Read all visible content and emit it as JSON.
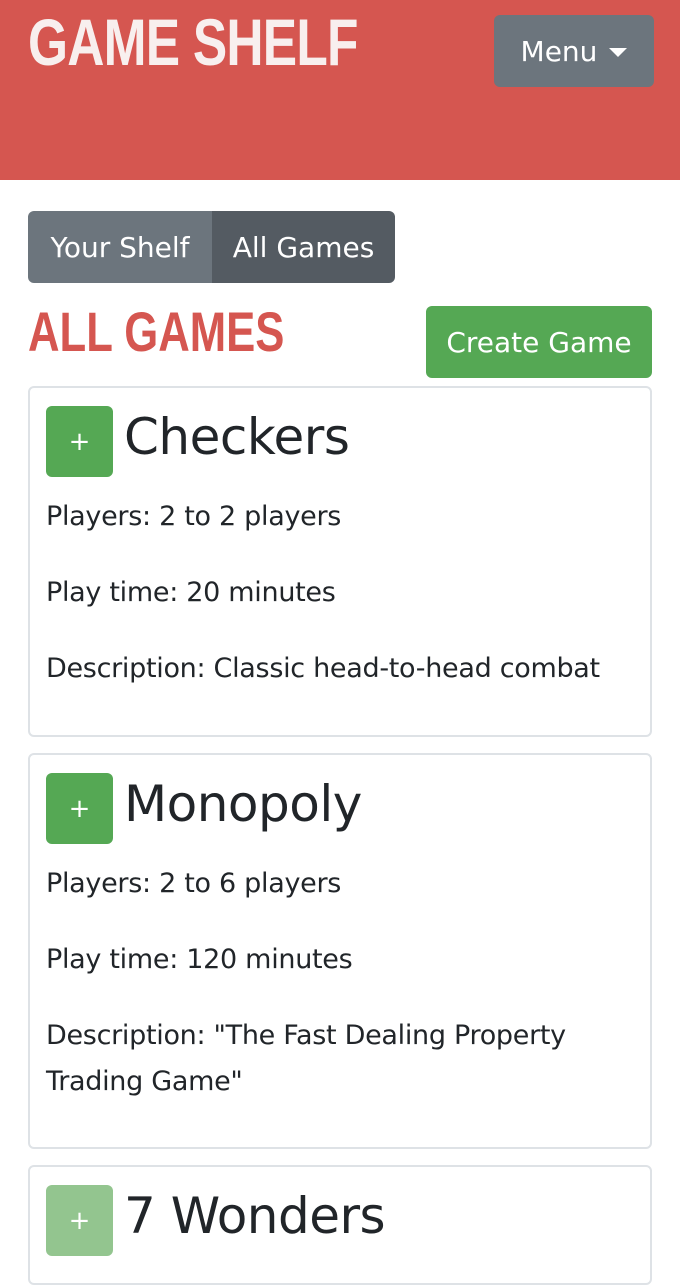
{
  "header": {
    "brand": "GAME SHELF",
    "menu_label": "Menu",
    "menu_icon": "chevron-down-icon"
  },
  "tabs": [
    {
      "label": "Your Shelf",
      "active": false
    },
    {
      "label": "All Games",
      "active": true
    }
  ],
  "main": {
    "title": "ALL GAMES",
    "create_label": "Create Game"
  },
  "colors": {
    "header_bg": "#d55650",
    "accent_green": "#55a854",
    "tab_gray": "#6c757d",
    "tab_active": "#545b62"
  },
  "games": [
    {
      "add_label": "+",
      "title": "Checkers",
      "players": "Players: 2 to 2 players",
      "play_time": "Play time: 20 minutes",
      "description": "Description: Classic head-to-head combat"
    },
    {
      "add_label": "+",
      "title": "Monopoly",
      "players": "Players: 2 to 6 players",
      "play_time": "Play time: 120 minutes",
      "description": "Description: \"The Fast Dealing Property Trading Game\""
    },
    {
      "add_label": "+",
      "title": "7 Wonders"
    }
  ]
}
